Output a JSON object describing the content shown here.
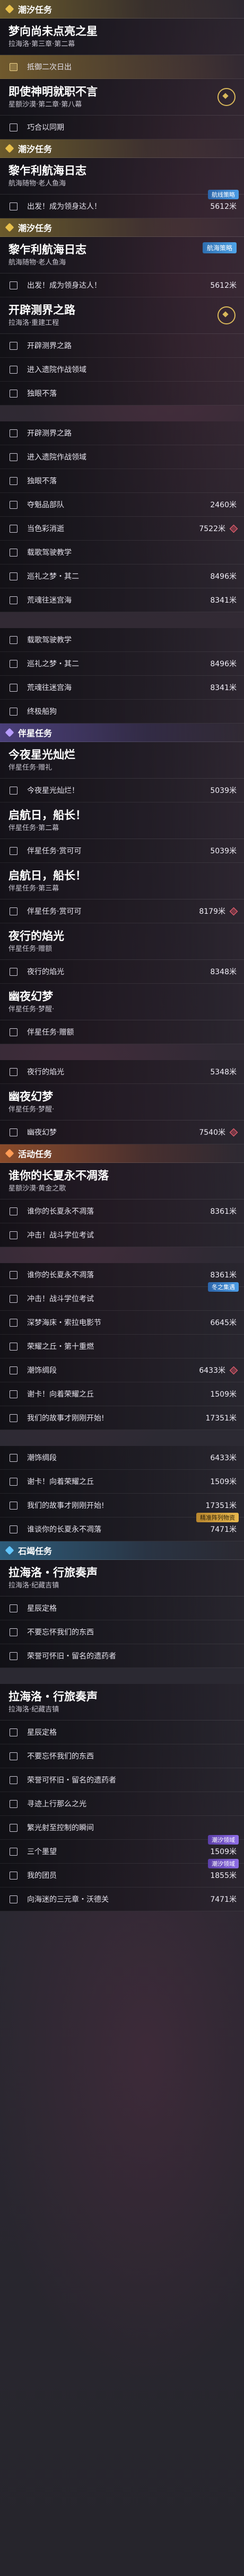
{
  "sections": [
    {
      "type": "header",
      "kind": "main",
      "name": "section-header-main",
      "title": "潮汐任务"
    },
    {
      "type": "mission",
      "title": "梦向尚未点亮之星",
      "sub": "拉海洛·第三章·第二幕",
      "track": false
    },
    {
      "type": "obj",
      "label": "抵御二次日出",
      "highlight": true
    },
    {
      "type": "mission",
      "title": "即使神明就职不言",
      "sub": "星额沙漠·第二章·第八幕",
      "track": true
    },
    {
      "type": "obj",
      "label": "巧合以同期"
    },
    {
      "type": "header",
      "kind": "main",
      "name": "section-header-main-2",
      "title": "潮汐任务"
    },
    {
      "type": "mission",
      "title": "黎乍利航海日志",
      "sub": "航海随物·老人鱼海",
      "track": false
    },
    {
      "type": "obj",
      "label": "出发！成为领身达人！",
      "dist": "5612米",
      "badge": "航线策略",
      "badgeColor": "blue"
    },
    {
      "type": "header",
      "kind": "main",
      "name": "section-header-main-3",
      "title": "潮汐任务"
    },
    {
      "type": "mission",
      "title": "黎乍利航海日志",
      "sub": "航海随物·老人鱼海",
      "track": false,
      "tag": "航海策略"
    },
    {
      "type": "obj",
      "label": "出发！成为领身达人！",
      "dist": "5612米"
    },
    {
      "type": "mission",
      "title": "开辟测界之路",
      "sub": "拉海洛·重建工程",
      "track": true
    },
    {
      "type": "obj",
      "label": "开辟测界之路"
    },
    {
      "type": "obj",
      "label": "进入遗院作战领域"
    },
    {
      "type": "obj",
      "label": "独眼不落"
    },
    {
      "type": "gap"
    },
    {
      "type": "obj",
      "label": "开辟测界之路"
    },
    {
      "type": "obj",
      "label": "进入遗院作战领域"
    },
    {
      "type": "obj",
      "label": "独眼不落"
    },
    {
      "type": "obj",
      "label": "夺魁品部队",
      "dist": "2460米"
    },
    {
      "type": "obj",
      "label": "当色彩消逝",
      "dist": "7522米",
      "marker": true
    },
    {
      "type": "obj",
      "label": "载歌驾驶教学"
    },
    {
      "type": "obj",
      "label": "巡礼之梦・其二",
      "dist": "8496米"
    },
    {
      "type": "obj",
      "label": "荒魂往迷宫海",
      "dist": "8341米"
    },
    {
      "type": "gap"
    },
    {
      "type": "obj",
      "label": "载歌驾驶教学"
    },
    {
      "type": "obj",
      "label": "巡礼之梦・其二",
      "dist": "8496米"
    },
    {
      "type": "obj",
      "label": "荒魂往迷宫海",
      "dist": "8341米"
    },
    {
      "type": "obj",
      "label": "终极船狗"
    },
    {
      "type": "header",
      "kind": "companion",
      "name": "section-header-companion",
      "title": "伴星任务"
    },
    {
      "type": "mission",
      "title": "今夜星光灿烂",
      "sub": "伴星任务·赠礼",
      "track": false
    },
    {
      "type": "obj",
      "label": "今夜星光灿烂！",
      "dist": "5039米"
    },
    {
      "type": "mission",
      "title": "启航日，船长！",
      "sub": "伴星任务·第二幕",
      "track": false
    },
    {
      "type": "obj",
      "label": "伴星任务·赏可可",
      "dist": "5039米"
    },
    {
      "type": "mission",
      "title": "启航日，船长！",
      "sub": "伴星任务·第三幕",
      "track": false
    },
    {
      "type": "obj",
      "label": "伴星任务·赏可可",
      "dist": "8179米",
      "marker": true
    },
    {
      "type": "mission",
      "title": "夜行的焰光",
      "sub": "伴星任务·赠额",
      "track": false
    },
    {
      "type": "obj",
      "label": "夜行的焰光",
      "dist": "8348米"
    },
    {
      "type": "mission",
      "title": "幽夜幻梦",
      "sub": "伴星任务·梦醒·",
      "track": false
    },
    {
      "type": "obj",
      "label": "伴星任务·赠额"
    },
    {
      "type": "gap"
    },
    {
      "type": "obj",
      "label": "夜行的焰光",
      "dist": "5348米"
    },
    {
      "type": "mission",
      "title": "幽夜幻梦",
      "sub": "伴星任务·梦醒·",
      "track": false
    },
    {
      "type": "obj",
      "label": "幽夜幻梦",
      "dist": "7540米",
      "marker": true
    },
    {
      "type": "header",
      "kind": "event",
      "name": "section-header-event",
      "title": "活动任务"
    },
    {
      "type": "mission",
      "title": "谁你的长夏永不凋落",
      "sub": "星额沙漠·黄金之歌",
      "track": false
    },
    {
      "type": "obj",
      "label": "谁你的长夏永不凋落",
      "dist": "8361米"
    },
    {
      "type": "obj",
      "label": "冲击！战斗学位考试"
    },
    {
      "type": "gap"
    },
    {
      "type": "obj",
      "label": "谁你的长夏永不凋落",
      "dist": "8361米"
    },
    {
      "type": "obj",
      "label": "冲击！战斗学位考试",
      "badge": "冬之集遇",
      "badgeColor": "blue"
    },
    {
      "type": "obj",
      "label": "深梦海床・索拉电影节",
      "dist": "6645米"
    },
    {
      "type": "obj",
      "label": "荣耀之丘・第十重燃"
    },
    {
      "type": "obj",
      "label": "潮饰绸段",
      "dist": "6433米",
      "marker": true
    },
    {
      "type": "obj",
      "label": "谢卡！向着荣耀之丘",
      "dist": "1509米"
    },
    {
      "type": "obj",
      "label": "我们的故事才刚刚开始!",
      "dist": "17351米"
    },
    {
      "type": "gap"
    },
    {
      "type": "obj",
      "label": "潮饰绸段",
      "dist": "6433米"
    },
    {
      "type": "obj",
      "label": "谢卡！向着荣耀之丘",
      "dist": "1509米"
    },
    {
      "type": "obj",
      "label": "我们的故事才刚刚开始!",
      "dist": "17351米"
    },
    {
      "type": "obj",
      "label": "谁谈你的长夏永不凋落",
      "dist": "7471米",
      "badge": "精准阵列物资",
      "badgeColor": "gold"
    },
    {
      "type": "header",
      "kind": "adventure",
      "name": "section-header-adventure",
      "title": "石竭任务"
    },
    {
      "type": "mission",
      "title": "拉海洛・行旅奏声",
      "sub": "拉海洛·纪藏吉镇",
      "track": false
    },
    {
      "type": "obj",
      "label": "星辰定格"
    },
    {
      "type": "obj",
      "label": "不要忘怀我们的东西"
    },
    {
      "type": "obj",
      "label": "荣誉可怀旧・留名的遗药者"
    },
    {
      "type": "gap"
    },
    {
      "type": "mission",
      "title": "拉海洛・行旅奏声",
      "sub": "拉海洛·纪藏吉镇",
      "track": false
    },
    {
      "type": "obj",
      "label": "星辰定格"
    },
    {
      "type": "obj",
      "label": "不要忘怀我们的东西"
    },
    {
      "type": "obj",
      "label": "荣誉可怀旧・留名的遗药者"
    },
    {
      "type": "obj",
      "label": "寻迹上行那么之光"
    },
    {
      "type": "obj",
      "label": "繁光射至控制的瞬间"
    },
    {
      "type": "obj",
      "label": "三个墨望",
      "dist": "1509米",
      "badge": "潮汐领域",
      "badgeColor": "purple"
    },
    {
      "type": "obj",
      "label": "我的团员",
      "dist": "1855米",
      "badge": "潮汐领域",
      "badgeColor": "purple"
    },
    {
      "type": "obj",
      "label": "向海迷的三元章・沃德关",
      "dist": "7471米"
    }
  ]
}
